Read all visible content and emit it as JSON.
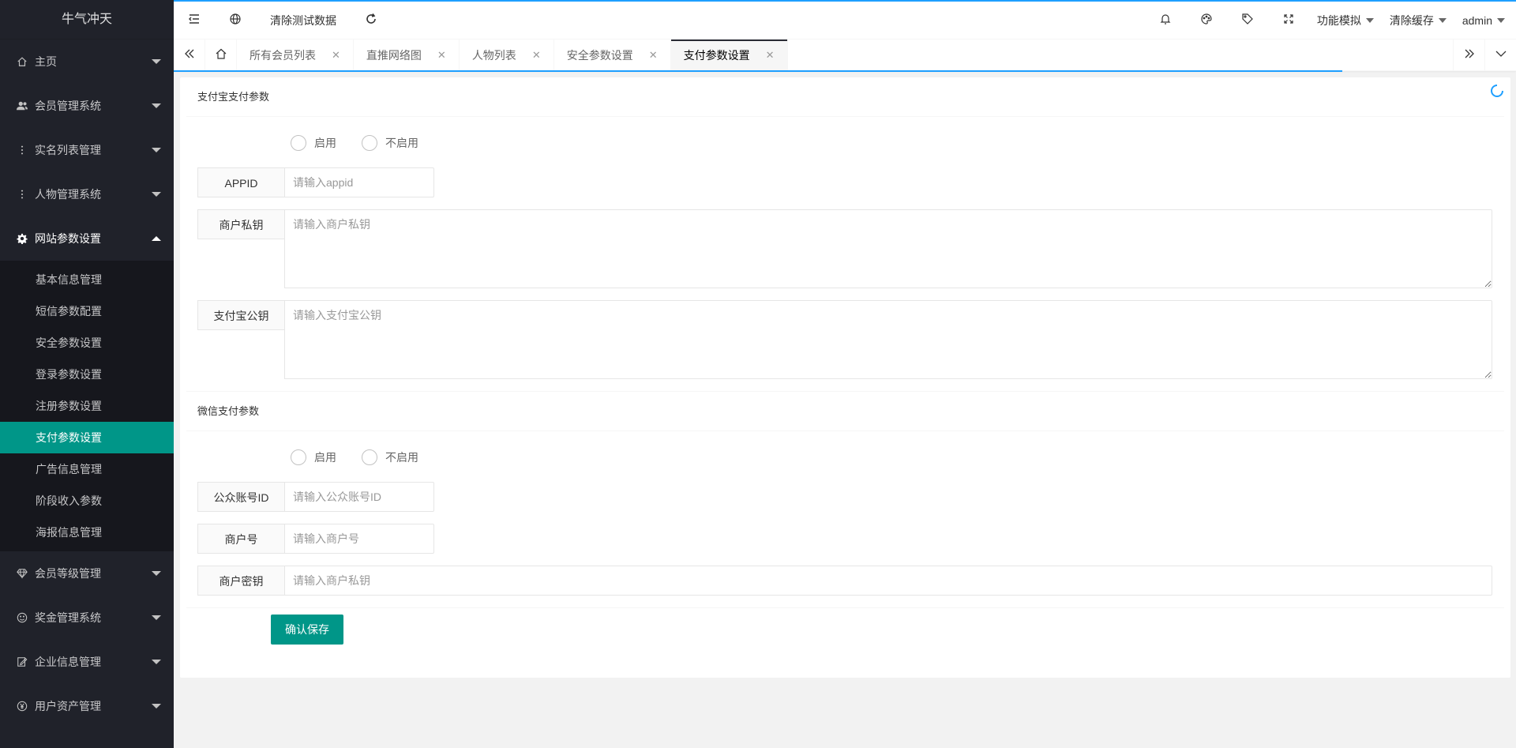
{
  "app": {
    "title": "牛气冲天"
  },
  "sidebar": {
    "menus": [
      {
        "label": "主页",
        "icon": "home-icon"
      },
      {
        "label": "会员管理系统",
        "icon": "users-icon"
      },
      {
        "label": "实名列表管理",
        "icon": "vertical-dots-icon"
      },
      {
        "label": "人物管理系统",
        "icon": "vertical-dots-icon"
      },
      {
        "label": "网站参数设置",
        "icon": "gear-icon",
        "open": true
      }
    ],
    "submenu": [
      {
        "label": "基本信息管理"
      },
      {
        "label": "短信参数配置"
      },
      {
        "label": "安全参数设置"
      },
      {
        "label": "登录参数设置"
      },
      {
        "label": "注册参数设置"
      },
      {
        "label": "支付参数设置",
        "active": true
      },
      {
        "label": "广告信息管理"
      },
      {
        "label": "阶段收入参数"
      },
      {
        "label": "海报信息管理"
      }
    ],
    "menus_after": [
      {
        "label": "会员等级管理",
        "icon": "diamond-icon"
      },
      {
        "label": "奖金管理系统",
        "icon": "smile-icon"
      },
      {
        "label": "企业信息管理",
        "icon": "edit-icon"
      },
      {
        "label": "用户资产管理",
        "icon": "yen-icon"
      }
    ]
  },
  "header": {
    "clear_test_data": "清除测试数据",
    "function_sim": "功能模拟",
    "clear_cache": "清除缓存",
    "user": "admin"
  },
  "tabs": [
    {
      "label": "所有会员列表"
    },
    {
      "label": "直推网络图"
    },
    {
      "label": "人物列表"
    },
    {
      "label": "安全参数设置"
    },
    {
      "label": "支付参数设置",
      "active": true
    }
  ],
  "alipay": {
    "section_title": "支付宝支付参数",
    "radio_enable": "启用",
    "radio_disable": "不启用",
    "appid_label": "APPID",
    "appid_placeholder": "请输入appid",
    "private_key_label": "商户私钥",
    "private_key_placeholder": "请输入商户私钥",
    "public_key_label": "支付宝公钥",
    "public_key_placeholder": "请输入支付宝公钥"
  },
  "wechat": {
    "section_title": "微信支付参数",
    "radio_enable": "启用",
    "radio_disable": "不启用",
    "account_label": "公众账号ID",
    "account_placeholder": "请输入公众账号ID",
    "merchant_no_label": "商户号",
    "merchant_no_placeholder": "请输入商户号",
    "merchant_key_label": "商户密钥",
    "merchant_key_placeholder": "请输入商户私钥"
  },
  "actions": {
    "save": "确认保存"
  },
  "colors": {
    "accent": "#009688",
    "sidebar_bg": "#20222a",
    "header_top": "#1e9fff"
  }
}
